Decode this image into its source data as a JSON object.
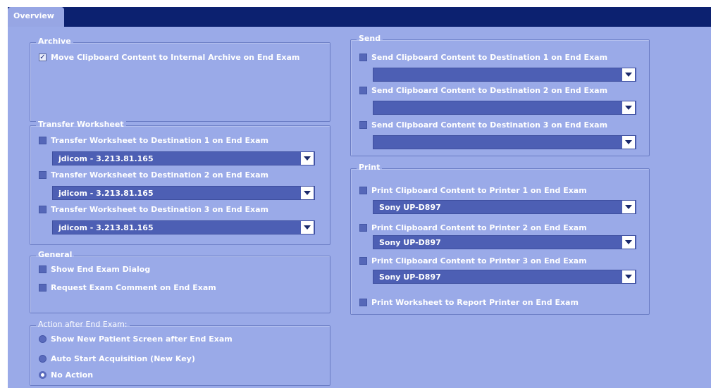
{
  "tab": {
    "label": "Overview"
  },
  "archive": {
    "title": "Archive",
    "move_clipboard": {
      "label": "Move Clipboard Content to Internal Archive on End Exam",
      "checked": true
    }
  },
  "transfer": {
    "title": "Transfer Worksheet",
    "items": [
      {
        "label": "Transfer Worksheet to Destination 1 on End Exam",
        "checked": false,
        "value": "jdicom - 3.213.81.165"
      },
      {
        "label": "Transfer Worksheet to Destination 2 on End Exam",
        "checked": false,
        "value": "jdicom - 3.213.81.165"
      },
      {
        "label": "Transfer Worksheet to Destination 3 on End Exam",
        "checked": false,
        "value": "jdicom - 3.213.81.165"
      }
    ]
  },
  "general": {
    "title": "General",
    "show_dialog": {
      "label": "Show End Exam Dialog",
      "checked": false
    },
    "request_comment": {
      "label": "Request Exam Comment on End Exam",
      "checked": false
    }
  },
  "action": {
    "title": "Action after End Exam:",
    "options": [
      {
        "label": "Show New Patient Screen after End Exam",
        "selected": false
      },
      {
        "label": "Auto Start Acquisition (New Key)",
        "selected": false
      },
      {
        "label": "No Action",
        "selected": true
      }
    ]
  },
  "send": {
    "title": "Send",
    "items": [
      {
        "label": "Send Clipboard Content to Destination 1 on End Exam",
        "checked": false,
        "value": ""
      },
      {
        "label": "Send Clipboard Content to Destination 2 on End Exam",
        "checked": false,
        "value": ""
      },
      {
        "label": "Send Clipboard Content to Destination 3 on End Exam",
        "checked": false,
        "value": ""
      }
    ]
  },
  "print": {
    "title": "Print",
    "items": [
      {
        "label": "Print Clipboard Content to Printer 1 on End Exam",
        "checked": false,
        "value": "Sony UP-D897"
      },
      {
        "label": "Print Clipboard Content to Printer 2 on End Exam",
        "checked": false,
        "value": "Sony UP-D897"
      },
      {
        "label": "Print Clipboard Content to Printer 3 on End Exam",
        "checked": false,
        "value": "Sony UP-D897"
      }
    ],
    "worksheet": {
      "label": "Print Worksheet to Report Printer on End Exam",
      "checked": false
    }
  },
  "colors": {
    "tab_bar": "#0c2170",
    "panel_bg": "#9aaae8",
    "dropdown_bg": "#4d5fb4",
    "text": "#ffffff"
  }
}
